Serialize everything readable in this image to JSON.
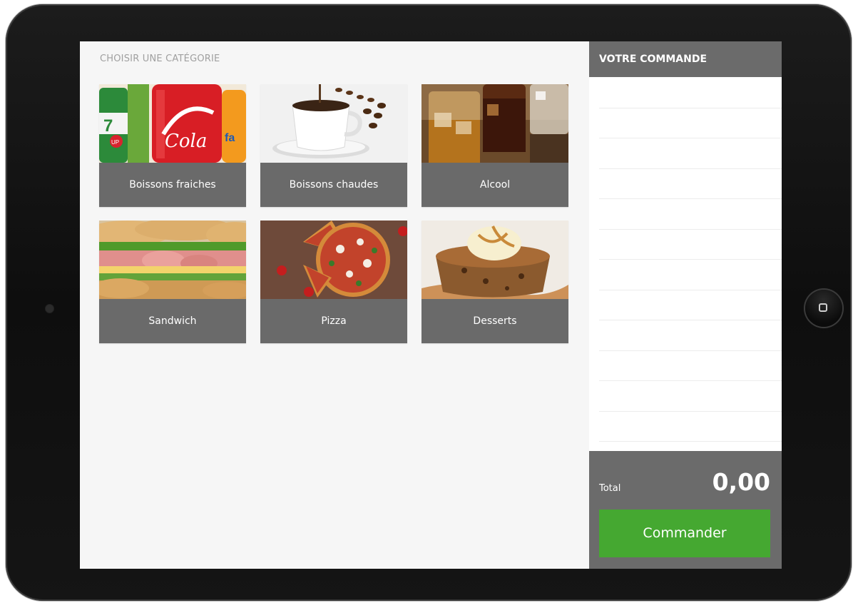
{
  "categories_title": "CHOISIR UNE CATÉGORIE",
  "categories": [
    {
      "label": "Boissons fraiches",
      "image": "soda-cans-photo"
    },
    {
      "label": "Boissons chaudes",
      "image": "coffee-cup-photo"
    },
    {
      "label": "Alcool",
      "image": "liquor-glasses-photo"
    },
    {
      "label": "Sandwich",
      "image": "sandwich-photo"
    },
    {
      "label": "Pizza",
      "image": "pizza-photo"
    },
    {
      "label": "Desserts",
      "image": "dessert-photo"
    }
  ],
  "order": {
    "title": "VOTRE COMMANDE",
    "total_label": "Total",
    "total_value": "0,00",
    "submit_label": "Commander"
  },
  "colors": {
    "tile_label_bg": "#6a6a6a",
    "panel_header_bg": "#6b6b6b",
    "submit_green": "#45a831"
  }
}
